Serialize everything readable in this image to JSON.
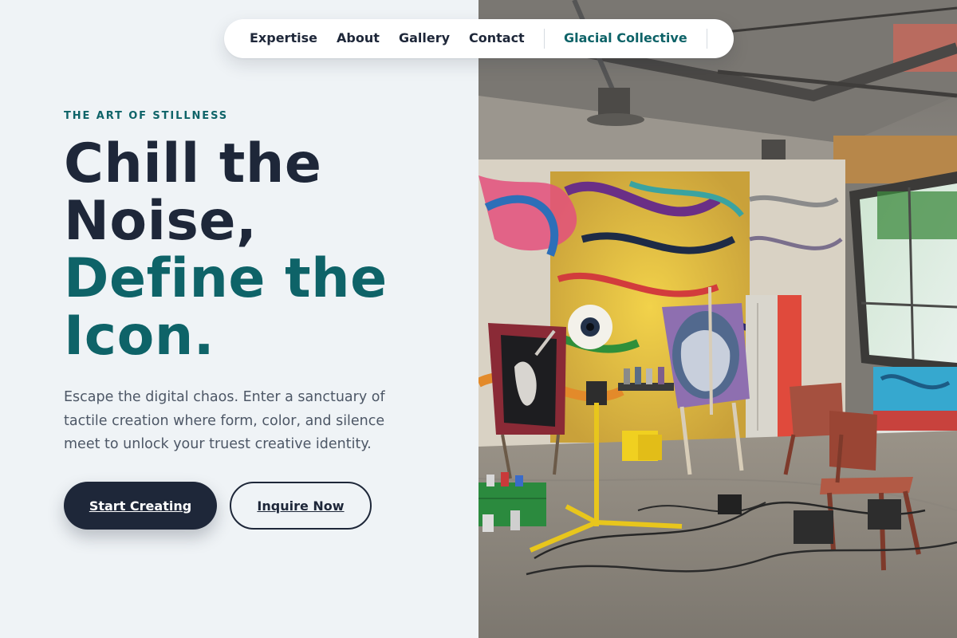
{
  "nav": {
    "items": [
      "Expertise",
      "About",
      "Gallery",
      "Contact"
    ],
    "brand": "Glacial Collective"
  },
  "hero": {
    "eyebrow": "THE ART OF STILLNESS",
    "headline_dark": [
      "Chill the",
      "Noise,"
    ],
    "headline_accent": [
      "Define the",
      "Icon."
    ],
    "lede": "Escape the digital chaos. Enter a sanctuary of tactile creation where form, color, and silence meet to unlock your truest creative identity.",
    "primary_button": "Start Creating",
    "secondary_button": "Inquire Now"
  },
  "colors": {
    "background": "#eff3f6",
    "ink": "#1e2739",
    "accent": "#0e6368",
    "body_text": "#4d5766"
  },
  "image": {
    "subject": "graffiti-covered art studio with easels, paintings, chairs and a work light"
  }
}
